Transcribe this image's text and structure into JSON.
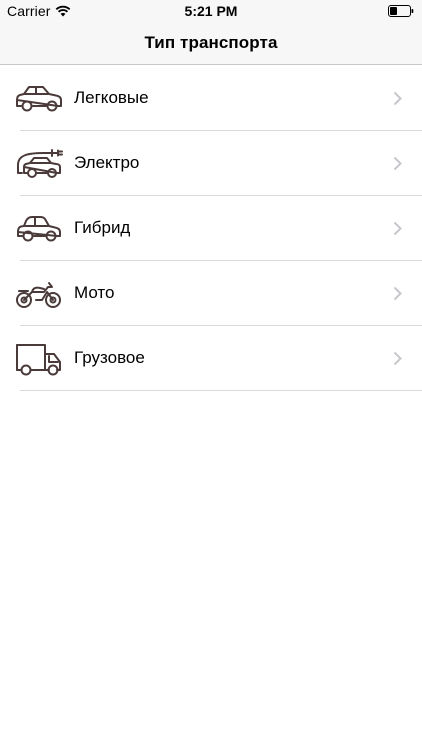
{
  "status_bar": {
    "carrier": "Carrier",
    "time": "5:21 PM",
    "icons": [
      "wifi-icon",
      "battery-icon"
    ]
  },
  "nav": {
    "title": "Тип транспорта"
  },
  "items": [
    {
      "label": "Легковые",
      "icon": "sedan-car-icon"
    },
    {
      "label": "Электро",
      "icon": "electric-car-icon"
    },
    {
      "label": "Гибрид",
      "icon": "hybrid-car-icon"
    },
    {
      "label": "Мото",
      "icon": "motorcycle-icon"
    },
    {
      "label": "Грузовое",
      "icon": "truck-icon"
    }
  ],
  "colors": {
    "icon_stroke": "#4a3a3a",
    "chevron": "#c7c7cc",
    "separator": "#d9d9d9",
    "bar_background": "#f7f7f7"
  }
}
